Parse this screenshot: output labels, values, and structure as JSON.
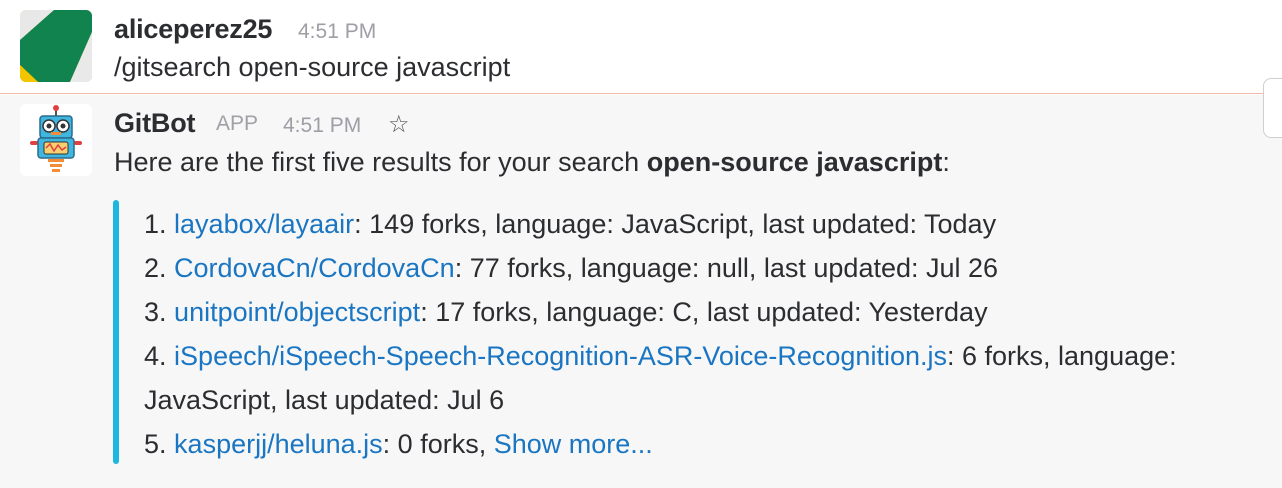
{
  "message_user": {
    "username": "aliceperez25",
    "time": "4:51 PM",
    "text": "/gitsearch open-source javascript"
  },
  "message_bot": {
    "name": "GitBot",
    "badge": "APP",
    "time": "4:51 PM",
    "intro_prefix": "Here are the first five results for your search",
    "query": "open-source javascript",
    "intro_suffix": ":",
    "accent_color": "#1db6e0",
    "results": [
      {
        "num": "1.",
        "repo": "layabox/layaair",
        "details": ": 149 forks,  language: JavaScript, last updated: Today"
      },
      {
        "num": "2.",
        "repo": "CordovaCn/CordovaCn",
        "details": ": 77 forks,  language: null, last updated: Jul 26"
      },
      {
        "num": "3.",
        "repo": "unitpoint/objectscript",
        "details": ": 17 forks,  language: C, last updated: Yesterday"
      },
      {
        "num": "4.",
        "repo": "iSpeech/iSpeech-Speech-Recognition-ASR-Voice-Recognition.js",
        "details": ": 6 forks,  language:",
        "details_cont": "JavaScript, last updated: Jul 6"
      },
      {
        "num": "5.",
        "repo": "kasperjj/heluna.js",
        "details": ": 0 forks, ",
        "show_more": "Show more..."
      }
    ]
  },
  "icons": {
    "star": "star-icon",
    "user_avatar": "user-avatar",
    "bot_avatar": "robot-avatar"
  }
}
